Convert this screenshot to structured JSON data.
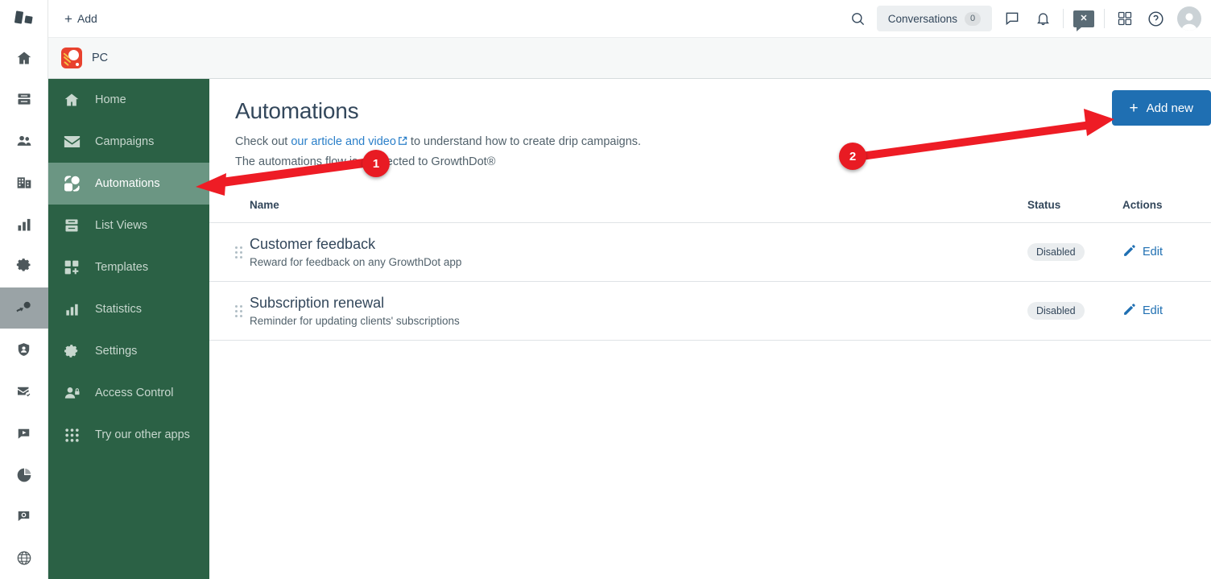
{
  "topbar": {
    "add_label": "Add",
    "add_plus": "+",
    "conversations_label": "Conversations",
    "conversations_count": "0",
    "icons": {
      "search": "search-icon",
      "chat": "chat-bubble-icon",
      "bell": "notifications-bell-icon",
      "chat_filled": "chat-close-icon",
      "grid": "marketplace-grid-icon",
      "help": "help-circle-icon",
      "avatar": "user-avatar"
    }
  },
  "appbar": {
    "portal_name": "PC",
    "logo": "product-logo-icon"
  },
  "rail": {
    "logo": "brand-logo-icon",
    "items": [
      {
        "name": "home",
        "label": "Home",
        "active": false
      },
      {
        "name": "database",
        "label": "Database",
        "active": false
      },
      {
        "name": "contacts",
        "label": "Contacts",
        "active": false
      },
      {
        "name": "companies",
        "label": "Companies",
        "active": false
      },
      {
        "name": "reports",
        "label": "Reports",
        "active": false
      },
      {
        "name": "settings",
        "label": "Settings",
        "active": false
      },
      {
        "name": "automations-app",
        "label": "Automations",
        "active": true
      },
      {
        "name": "shield-user",
        "label": "Access",
        "active": false
      },
      {
        "name": "mail-check",
        "label": "Mail",
        "active": false
      },
      {
        "name": "video",
        "label": "Video",
        "active": false
      },
      {
        "name": "pie-chart",
        "label": "Analytics",
        "active": false
      },
      {
        "name": "chat-refresh",
        "label": "Chat",
        "active": false
      },
      {
        "name": "globe",
        "label": "Web",
        "active": false
      }
    ]
  },
  "sidebar": {
    "items": [
      {
        "icon": "home-icon",
        "label": "Home",
        "active": false
      },
      {
        "icon": "envelope-icon",
        "label": "Campaigns",
        "active": false
      },
      {
        "icon": "automations-icon",
        "label": "Automations",
        "active": true
      },
      {
        "icon": "list-views-icon",
        "label": "List Views",
        "active": false
      },
      {
        "icon": "templates-icon",
        "label": "Templates",
        "active": false
      },
      {
        "icon": "statistics-icon",
        "label": "Statistics",
        "active": false
      },
      {
        "icon": "gear-icon",
        "label": "Settings",
        "active": false
      },
      {
        "icon": "access-control-icon",
        "label": "Access Control",
        "active": false
      },
      {
        "icon": "apps-grid-icon",
        "label": "Try our other apps",
        "active": false
      }
    ]
  },
  "main": {
    "title": "Automations",
    "sub_prefix": "Check out ",
    "sub_link": "our article and video",
    "sub_suffix": " to understand how to create drip campaigns.",
    "sub_line2": "The automations flow is connected to GrowthDot®",
    "add_new_label": "Add new",
    "add_new_plus": "+"
  },
  "table": {
    "columns": [
      "Name",
      "Status",
      "Actions"
    ],
    "rows": [
      {
        "name": "Customer feedback",
        "description": "Reward for feedback on any GrowthDot app",
        "status": "Disabled",
        "action": "Edit"
      },
      {
        "name": "Subscription renewal",
        "description": "Reminder for updating clients' subscriptions",
        "status": "Disabled",
        "action": "Edit"
      }
    ]
  },
  "annotations": [
    {
      "number": "1",
      "target": "sidebar-item-automations"
    },
    {
      "number": "2",
      "target": "add-new-button"
    }
  ],
  "colors": {
    "sidebar_green": "#2b6145",
    "sidebar_active_green": "#6b9683",
    "primary_blue": "#1f6fb2",
    "link_blue": "#2a7fc9",
    "annotation_red": "#e81b23",
    "badge_gray": "#eaedef",
    "appbar_gray": "#f6f8f8"
  }
}
